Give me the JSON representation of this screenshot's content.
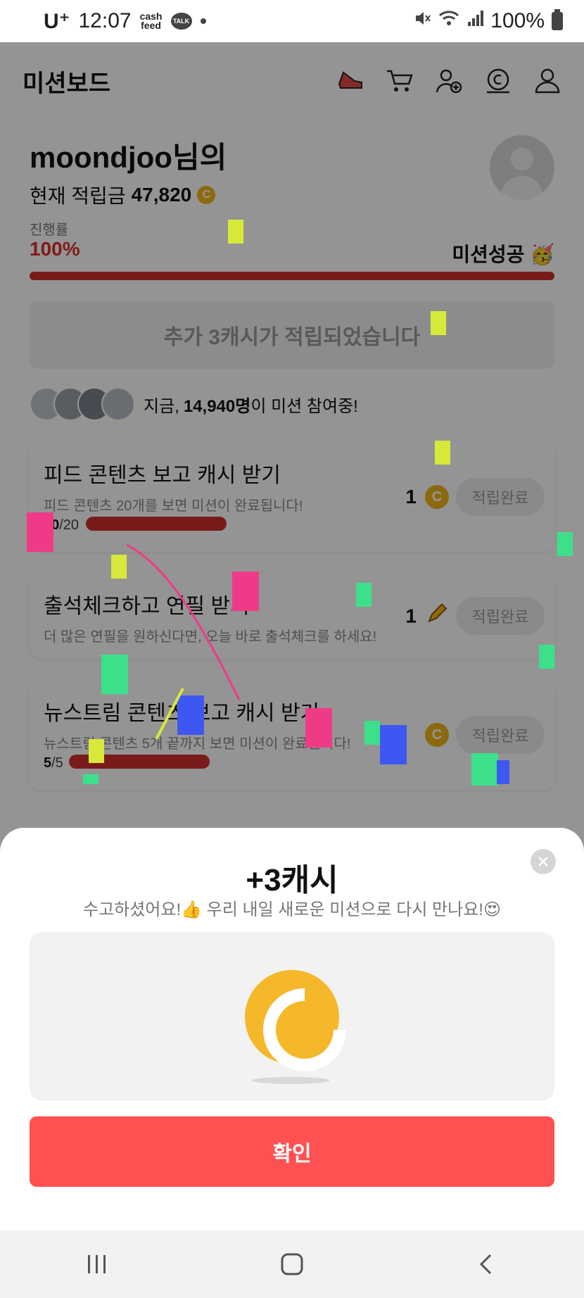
{
  "status_bar": {
    "carrier": "U⁺",
    "time": "12:07",
    "mini_app": "cash\nfeed",
    "talk_badge": "TALK",
    "battery": "100%"
  },
  "header": {
    "title": "미션보드",
    "icons": [
      "shoe-icon",
      "cart-icon",
      "add-friend-icon",
      "cash-coin-icon",
      "profile-icon"
    ]
  },
  "profile": {
    "name": "moondjoo님의",
    "points_label": "현재 적립금",
    "points_value": "47,820",
    "coin_symbol": "C"
  },
  "progress": {
    "label": "진행률",
    "value_text": "100%",
    "fraction": 1.0,
    "status": "미션성공 🥳"
  },
  "notice": "추가 3캐시가 적립되었습니다",
  "participants": {
    "prefix": "지금,",
    "count": "14,940명",
    "suffix": "이 미션 참여중!"
  },
  "missions": [
    {
      "title": "피드 콘텐츠 보고 캐시 받기",
      "desc": "피드 콘텐츠 20개를 보면 미션이 완료됩니다!",
      "count_done": "20",
      "count_total": "/20",
      "progress": 1.0,
      "reward": "1",
      "reward_icon": "cash-coin-icon",
      "button": "적립완료"
    },
    {
      "title": "출석체크하고 연필 받기",
      "desc": "더 많은 연필을 원하신다면, 오늘 바로 출석체크를 하세요!",
      "reward": "1",
      "reward_icon": "pencil-icon",
      "button": "적립완료"
    },
    {
      "title": "뉴스트림 콘텐츠 보고 캐시 받기",
      "desc": "뉴스트림 콘텐츠 5개 끝까지 보면 미션이 완료됩니다!",
      "count_done": "5",
      "count_total": "/5",
      "progress": 1.0,
      "reward": "",
      "reward_icon": "cash-coin-icon",
      "button": "적립완료"
    }
  ],
  "sheet": {
    "title": "+3캐시",
    "subtitle": "수고하셨어요!👍 우리 내일 새로운 미션으로 다시 만나요!😍",
    "coin_icon": "cash-coin-icon",
    "confirm": "확인",
    "close_icon": "close-icon"
  },
  "navbar": [
    "recent-apps-icon",
    "home-icon",
    "back-icon"
  ],
  "colors": {
    "accent_red": "#d32f2f",
    "confirm_button": "#ff5152",
    "coin_gold": "#f5b82a"
  }
}
